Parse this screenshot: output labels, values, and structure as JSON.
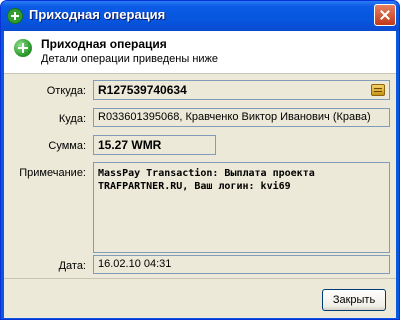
{
  "window": {
    "title": "Приходная операция"
  },
  "header": {
    "title": "Приходная операция",
    "subtitle": "Детали операции приведены ниже"
  },
  "fields": {
    "from": {
      "label": "Откуда:",
      "value": "R127539740634"
    },
    "to": {
      "label": "Куда:",
      "value": "R033601395068, Кравченко Виктор Иванович (Крава)"
    },
    "amount": {
      "label": "Сумма:",
      "value": "15.27 WMR"
    },
    "note": {
      "label": "Примечание:",
      "value": "MassPay Transaction: Выплата проекта TRAFPARTNER.RU, Ваш логин: kvi69"
    },
    "date": {
      "label": "Дата:",
      "value": "16.02.10 04:31"
    }
  },
  "buttons": {
    "close": "Закрыть"
  }
}
